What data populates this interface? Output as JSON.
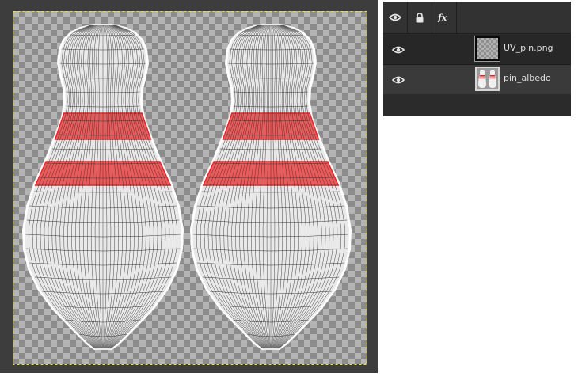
{
  "canvas": {
    "background": "#3d3d3d",
    "selection_color": "#f2e33a",
    "pin_fill": "#e9e9e9",
    "stripe_color": "#ee5a5a",
    "stripe_edge_color": "#e0242a"
  },
  "layers_panel": {
    "header_icons": [
      "visibility-icon",
      "lock-icon",
      "fx-icon"
    ],
    "layers": [
      {
        "name": "UV_pin.png",
        "visible": true,
        "thumbnail": "transparent-checker",
        "selected": true
      },
      {
        "name": "pin_albedo",
        "visible": true,
        "thumbnail": "bowling-pins",
        "selected": false
      }
    ]
  }
}
